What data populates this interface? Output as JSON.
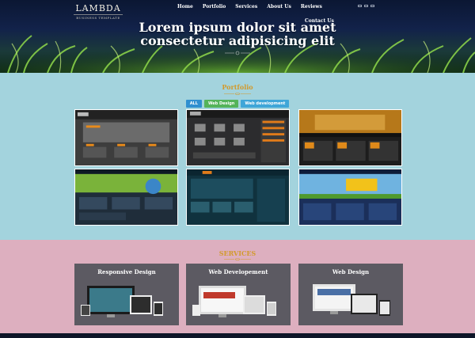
{
  "brand": {
    "name": "LAMBDA",
    "tagline": "BUSINESS TEMPLATE"
  },
  "nav": {
    "items": [
      "Home",
      "Portfolio",
      "Services",
      "About Us",
      "Reviews"
    ],
    "contact": "Contact Us"
  },
  "hero": {
    "line1": "Lorem ipsum dolor sit amet",
    "line2": "consectetur adipisicing elit"
  },
  "portfolio": {
    "title": "Portfolio",
    "filters": [
      "ALL",
      "Web Design",
      "Web development"
    ]
  },
  "services": {
    "title": "SERVICES",
    "items": [
      {
        "title": "Responsive Design"
      },
      {
        "title": "Web Developement"
      },
      {
        "title": "Web Design"
      }
    ]
  },
  "colors": {
    "portfolio_bg": "#a3d3dd",
    "services_bg": "#ddafbf",
    "accent_gold": "#d29a2c",
    "service_card": "#5c5a62"
  }
}
